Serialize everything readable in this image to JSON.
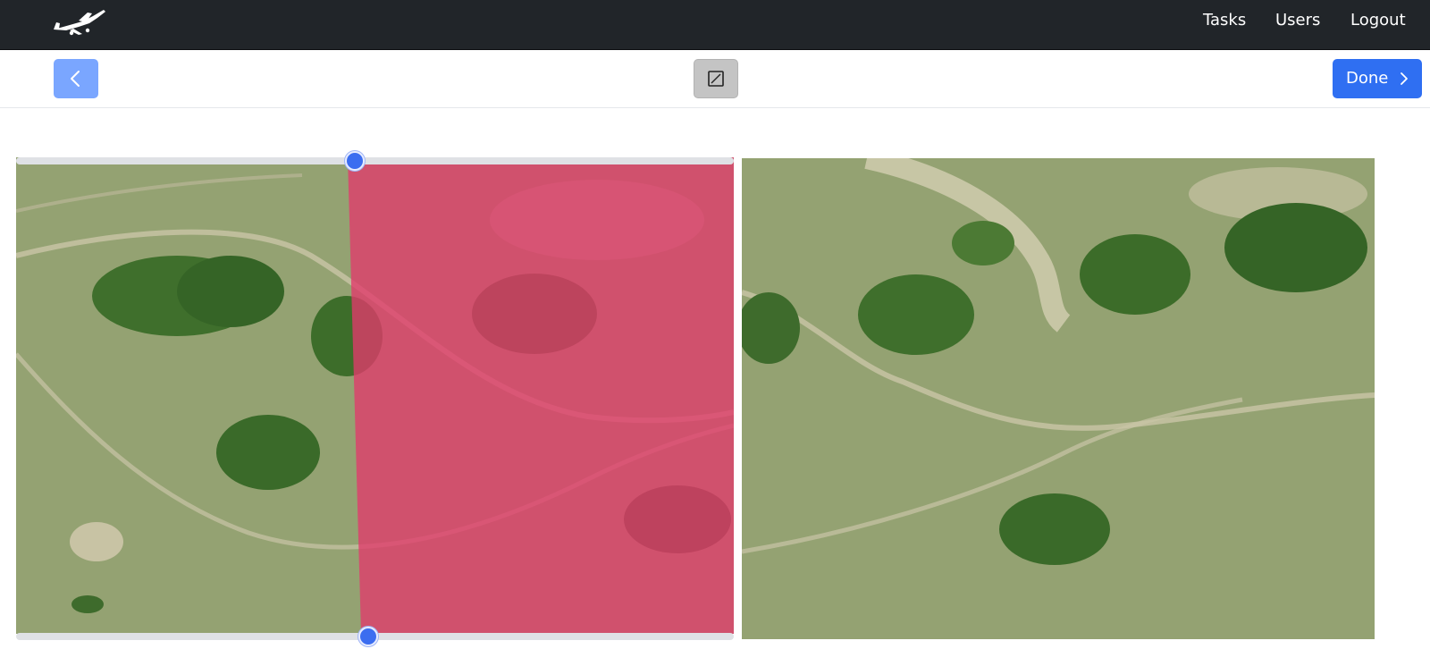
{
  "navbar": {
    "logo_icon": "airplane-logo-icon",
    "links": [
      {
        "label": "Tasks"
      },
      {
        "label": "Users"
      },
      {
        "label": "Logout"
      }
    ],
    "background": "#212529"
  },
  "toolbar": {
    "back_icon": "chevron-left-icon",
    "edit_icon": "edit-square-icon",
    "done_label": "Done",
    "done_icon": "chevron-right-icon",
    "accent": "#2f6ff2"
  },
  "editor": {
    "left_image": "aerial-field-photo",
    "right_image": "aerial-field-photo",
    "mask_color": "#d93b68",
    "top_handle_fraction": 0.47,
    "bottom_handle_fraction": 0.49
  }
}
